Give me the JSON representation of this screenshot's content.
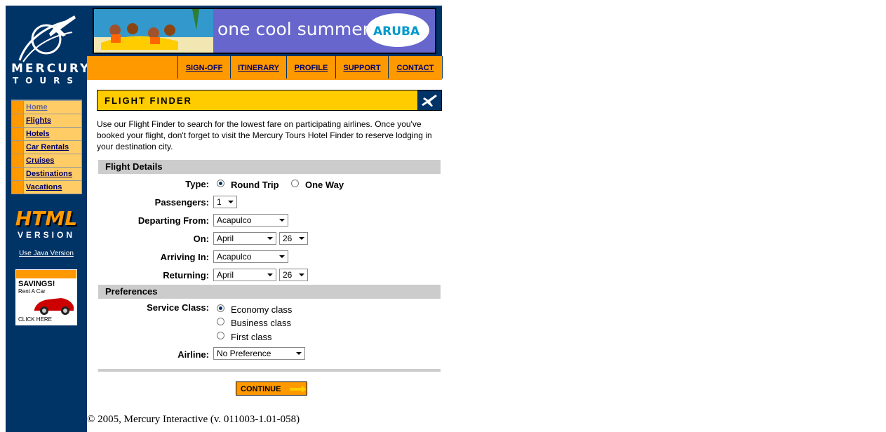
{
  "brand": {
    "line1": "MERCURY",
    "line2": "TOURS"
  },
  "sidebar": {
    "items": [
      {
        "label": "Home"
      },
      {
        "label": "Flights"
      },
      {
        "label": "Hotels"
      },
      {
        "label": "Car Rentals"
      },
      {
        "label": "Cruises"
      },
      {
        "label": "Destinations"
      },
      {
        "label": "Vacations"
      }
    ],
    "html_version": {
      "big": "HTML",
      "small": "VERSION"
    },
    "java_link": "Use Java Version",
    "ad": {
      "title": "SAVINGS!",
      "sub": "Rent A Car",
      "cta": "CLICK HERE"
    }
  },
  "banner": {
    "slogan": "one cool summer",
    "logo_text": "ARUBA"
  },
  "topnav": {
    "items": [
      {
        "label": "SIGN-OFF"
      },
      {
        "label": "ITINERARY"
      },
      {
        "label": "PROFILE"
      },
      {
        "label": "SUPPORT"
      },
      {
        "label": "CONTACT"
      }
    ]
  },
  "page": {
    "title": "FLIGHT FINDER",
    "intro": "Use our Flight Finder to search for the lowest fare on participating airlines. Once you've booked your flight, don't forget to visit the Mercury Tours Hotel Finder to reserve lodging in your destination city."
  },
  "flight_details": {
    "heading": "Flight Details",
    "type_label": "Type:",
    "type_options": [
      "Round Trip",
      "One Way"
    ],
    "type_selected": "Round Trip",
    "passengers_label": "Passengers:",
    "passengers_value": "1",
    "departing_label": "Departing From:",
    "departing_value": "Acapulco",
    "on_label": "On:",
    "on_month": "April",
    "on_day": "26",
    "arriving_label": "Arriving In:",
    "arriving_value": "Acapulco",
    "returning_label": "Returning:",
    "returning_month": "April",
    "returning_day": "26"
  },
  "preferences": {
    "heading": "Preferences",
    "service_label": "Service Class:",
    "service_options": [
      "Economy class",
      "Business class",
      "First class"
    ],
    "service_selected": "Economy class",
    "airline_label": "Airline:",
    "airline_value": "No Preference"
  },
  "continue_label": "CONTINUE",
  "copyright": "© 2005, Mercury Interactive (v. 011003-1.01-058)",
  "colors": {
    "navy": "#003366",
    "orange": "#ff9900",
    "yellow": "#ffcc00",
    "light_orange": "#ffcc66",
    "grey": "#cccccc"
  }
}
